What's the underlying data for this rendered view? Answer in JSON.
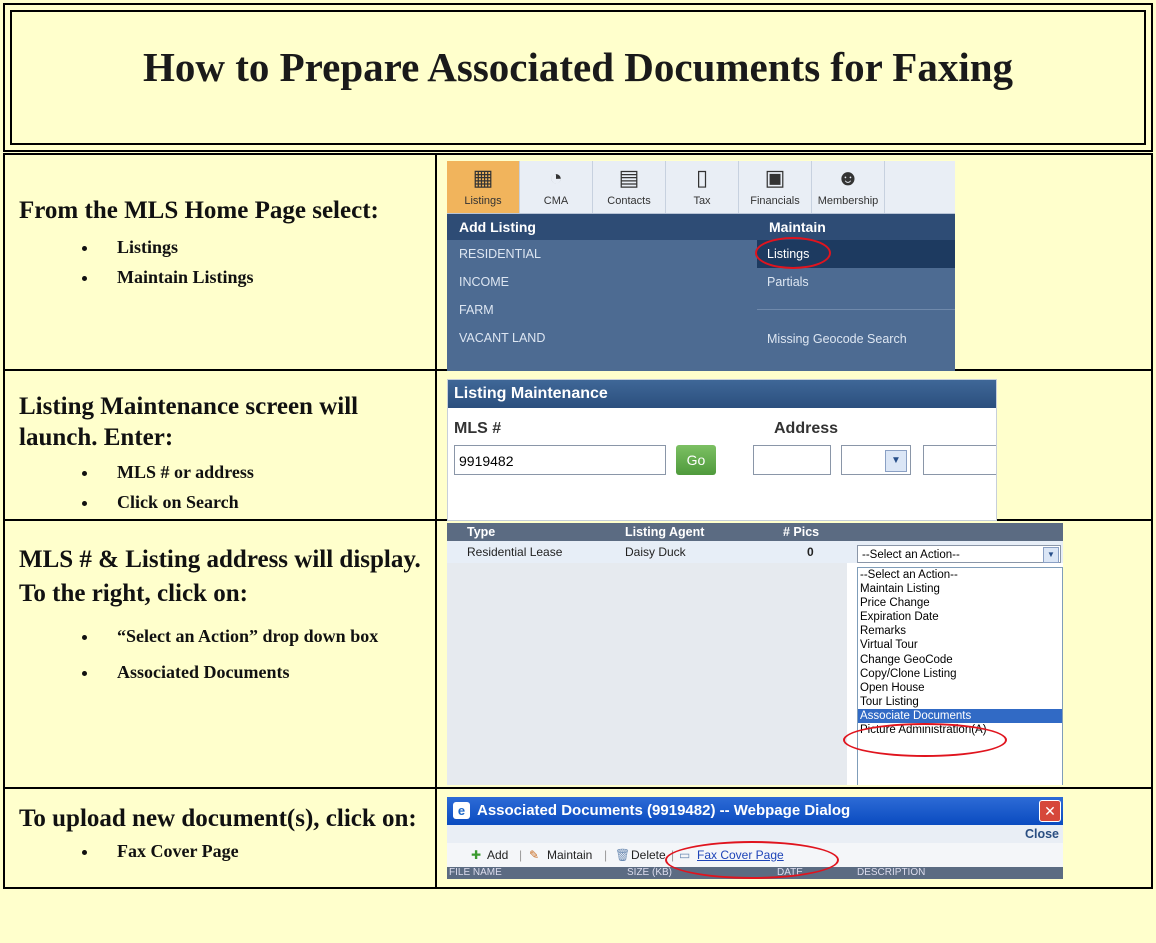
{
  "title": "How to Prepare Associated Documents for Faxing",
  "steps": [
    {
      "lead": "From the MLS Home Page select:",
      "bullets": [
        "Listings",
        "Maintain Listings"
      ]
    },
    {
      "lead": "Listing Maintenance screen will launch.  Enter:",
      "bullets": [
        "MLS # or address",
        "Click on Search"
      ]
    },
    {
      "lead": "MLS # & Listing address will display.  To the right, click on:",
      "bullets": [
        "“Select an Action” drop down box",
        "Associated Documents"
      ]
    },
    {
      "lead": "To upload new document(s), click on:",
      "bullets": [
        "Fax Cover Page"
      ]
    }
  ],
  "nav_screenshot": {
    "tabs": [
      "Listings",
      "CMA",
      "Contacts",
      "Tax",
      "Financials",
      "Membership"
    ],
    "active_tab": "Listings",
    "add_listing_header": "Add Listing",
    "maintain_header": "Maintain",
    "add_listing_items": [
      "RESIDENTIAL",
      "INCOME",
      "FARM",
      "VACANT LAND"
    ],
    "maintain_items": [
      "Listings",
      "Partials",
      "",
      "Missing Geocode Search"
    ],
    "highlighted_item": "Listings"
  },
  "listing_maintenance_screenshot": {
    "header": "Listing Maintenance",
    "mls_label": "MLS #",
    "address_label": "Address",
    "mls_value": "9919482",
    "go_label": "Go"
  },
  "results_screenshot": {
    "headers": [
      "Type",
      "Listing Agent",
      "# Pics"
    ],
    "row": [
      "Residential Lease",
      "Daisy Duck",
      "0"
    ],
    "select_value": "--Select an Action--",
    "options": [
      "--Select an Action--",
      "Maintain Listing",
      "Price Change",
      "Expiration Date",
      "Remarks",
      "Virtual Tour",
      "Change GeoCode",
      "Copy/Clone Listing",
      "Open House",
      "Tour Listing",
      "Associate Documents",
      "Picture Administration(A)"
    ],
    "highlighted_option": "Associate Documents"
  },
  "dialog_screenshot": {
    "title": "Associated Documents (9919482) -- Webpage Dialog",
    "close_label": "Close",
    "tools": [
      "Add",
      "Maintain",
      "Delete",
      "Fax Cover Page"
    ],
    "columns": [
      "FILE NAME",
      "SIZE (KB)",
      "DATE",
      "DESCRIPTION"
    ]
  }
}
